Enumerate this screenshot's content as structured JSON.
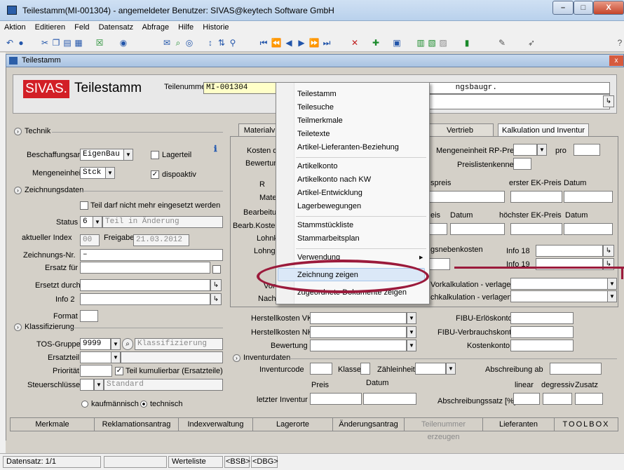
{
  "window": {
    "title": "Teilestamm(MI-001304) - angemeldeter Benutzer: SIVAS@keytech Software GmbH",
    "min": "–",
    "max": "□",
    "close": "X"
  },
  "menu": [
    "Aktion",
    "Editieren",
    "Feld",
    "Datensatz",
    "Abfrage",
    "Hilfe",
    "Historie"
  ],
  "inner_window": {
    "title": "Teilestamm",
    "close": "x"
  },
  "header": {
    "logo": "SIVAS.",
    "module": "Teilestamm",
    "teilenummer_label": "Teilenummer",
    "teilenummer_value": "MI-001304",
    "bez_label": "Bezeichnung",
    "bez_value": "ngsbaugr."
  },
  "technik": {
    "section": "Technik",
    "beschaffungsart_label": "Beschaffungsart",
    "beschaffungsart_value": "EigenBau",
    "lagerteil_label": "Lagerteil",
    "mengeneinheit_label": "Mengeneinheit",
    "mengeneinheit_value": "Stck",
    "dispoaktiv_label": "dispoaktiv"
  },
  "zeichnung": {
    "section": "Zeichnungsdaten",
    "nicht_mehr_label": "Teil darf nicht mehr eingesetzt werden",
    "status_label": "Status",
    "status_code": "6",
    "status_text": "Teil in Änderung",
    "index_label": "aktueller Index",
    "index_value": "00",
    "freigabe_label": "Freigabe",
    "freigabe_value": "21.03.2012",
    "zeichnungsnr_label": "Zeichnungs-Nr.",
    "zeichnungsnr_value": "–",
    "ersatz_fuer_label": "Ersatz für",
    "ersetzt_durch_label": "Ersetzt durch",
    "info2_label": "Info 2",
    "format_label": "Format"
  },
  "klassifizierung": {
    "section": "Klassifizierung",
    "tos_label": "TOS-Gruppe",
    "tos_value": "9999",
    "klass_placeholder": "Klassifizierung",
    "ersatzteil_label": "Ersatzteil",
    "prioritaet_label": "Priorität",
    "kumulierbar_label": "Teil kumulierbar (Ersatzteile)",
    "steuer_label": "Steuerschlüssel",
    "steuer_value": "Standard",
    "kaufm_label": "kaufmännisch",
    "techn_label": "technisch"
  },
  "tabs": [
    "Materialv",
    "Vertrieb",
    "Kalkulation und Inventur"
  ],
  "right": {
    "kosten_label": "Kosten da",
    "bewertung_label": "Bewertun",
    "r_label": "R",
    "mate_label": "Mate",
    "bearbeitung_label": "Bearbeitun",
    "bearbkosten_label": "Bearb.Koster",
    "lohnk_label": "Lohnk",
    "lohngr_label": "Lohngr",
    "vork_label": "Vork",
    "nachk_label": "Nachk",
    "me_rp_label": "Mengeneinheit RP-Preis",
    "pro_label": "pro",
    "preislisten_label": "Preislistenkenner",
    "spreis_label": "spreis",
    "erster_ek_label": "erster EK-Preis",
    "datum_label": "Datum",
    "eis_label": "eis",
    "datum2_label": "Datum",
    "hoechster_label": "höchster EK-Preis",
    "datum3_label": "Datum",
    "gsneben_label": "gsnebenkosten",
    "info18_label": "Info 18",
    "info19_label": "Info 19",
    "vorkalk_label": "Vorkalkulation - verlagert",
    "nachkalk_label": "chkalkulation - verlagert",
    "hk_vk_label": "Herstellkosten VK",
    "hk_nk_label": "Herstellkosten NK",
    "bewertung2_label": "Bewertung",
    "fibu_erl_label": "FIBU-Erlöskonto",
    "fibu_verb_label": "FIBU-Verbrauchskonto",
    "kostenkonto_label": "Kostenkonto",
    "inventurdaten_label": "Inventurdaten",
    "inventurcode_label": "Inventurcode",
    "klasse_label": "Klasse",
    "zaehleinheit_label": "Zähleinheit",
    "abschreibung_ab_label": "Abschreibung ab",
    "preis_label": "Preis",
    "datum4_label": "Datum",
    "linear_label": "linear",
    "degressiv_label": "degressiv",
    "zusatz_label": "Zusatz",
    "letzter_label": "letzter Inventur",
    "abschreibungssatz_label": "Abschreibungssatz [%]"
  },
  "context_menu": {
    "items": [
      "Teilestamm",
      "Teilesuche",
      "Teilmerkmale",
      "Teiletexte",
      "Artikel-Lieferanten-Beziehung",
      "Artikelkonto",
      "Artikelkonto nach KW",
      "Artikel-Entwicklung",
      "Lagerbewegungen",
      "Stammstückliste",
      "Stammarbeitsplan",
      "Verwendung",
      "Zeichnung zeigen",
      "zugeordnete Dokumente zeigen"
    ],
    "submenu_arrow": "▶"
  },
  "bottom_tabs": [
    "Merkmale",
    "Reklamationsantrag",
    "Indexverwaltung",
    "Lagerorte",
    "Änderungsantrag",
    "Teilenummer erzeugen",
    "Lieferanten",
    "TOOLBOX"
  ],
  "status": {
    "datensatz": "Datensatz: 1/1",
    "werteliste": "Werteliste",
    "bsb": "<BSB>",
    "dbg": "<DBG>"
  },
  "colors": {
    "accent": "#9b1a3b",
    "logo": "#d21f26",
    "highlight": "#dbe8f7"
  }
}
